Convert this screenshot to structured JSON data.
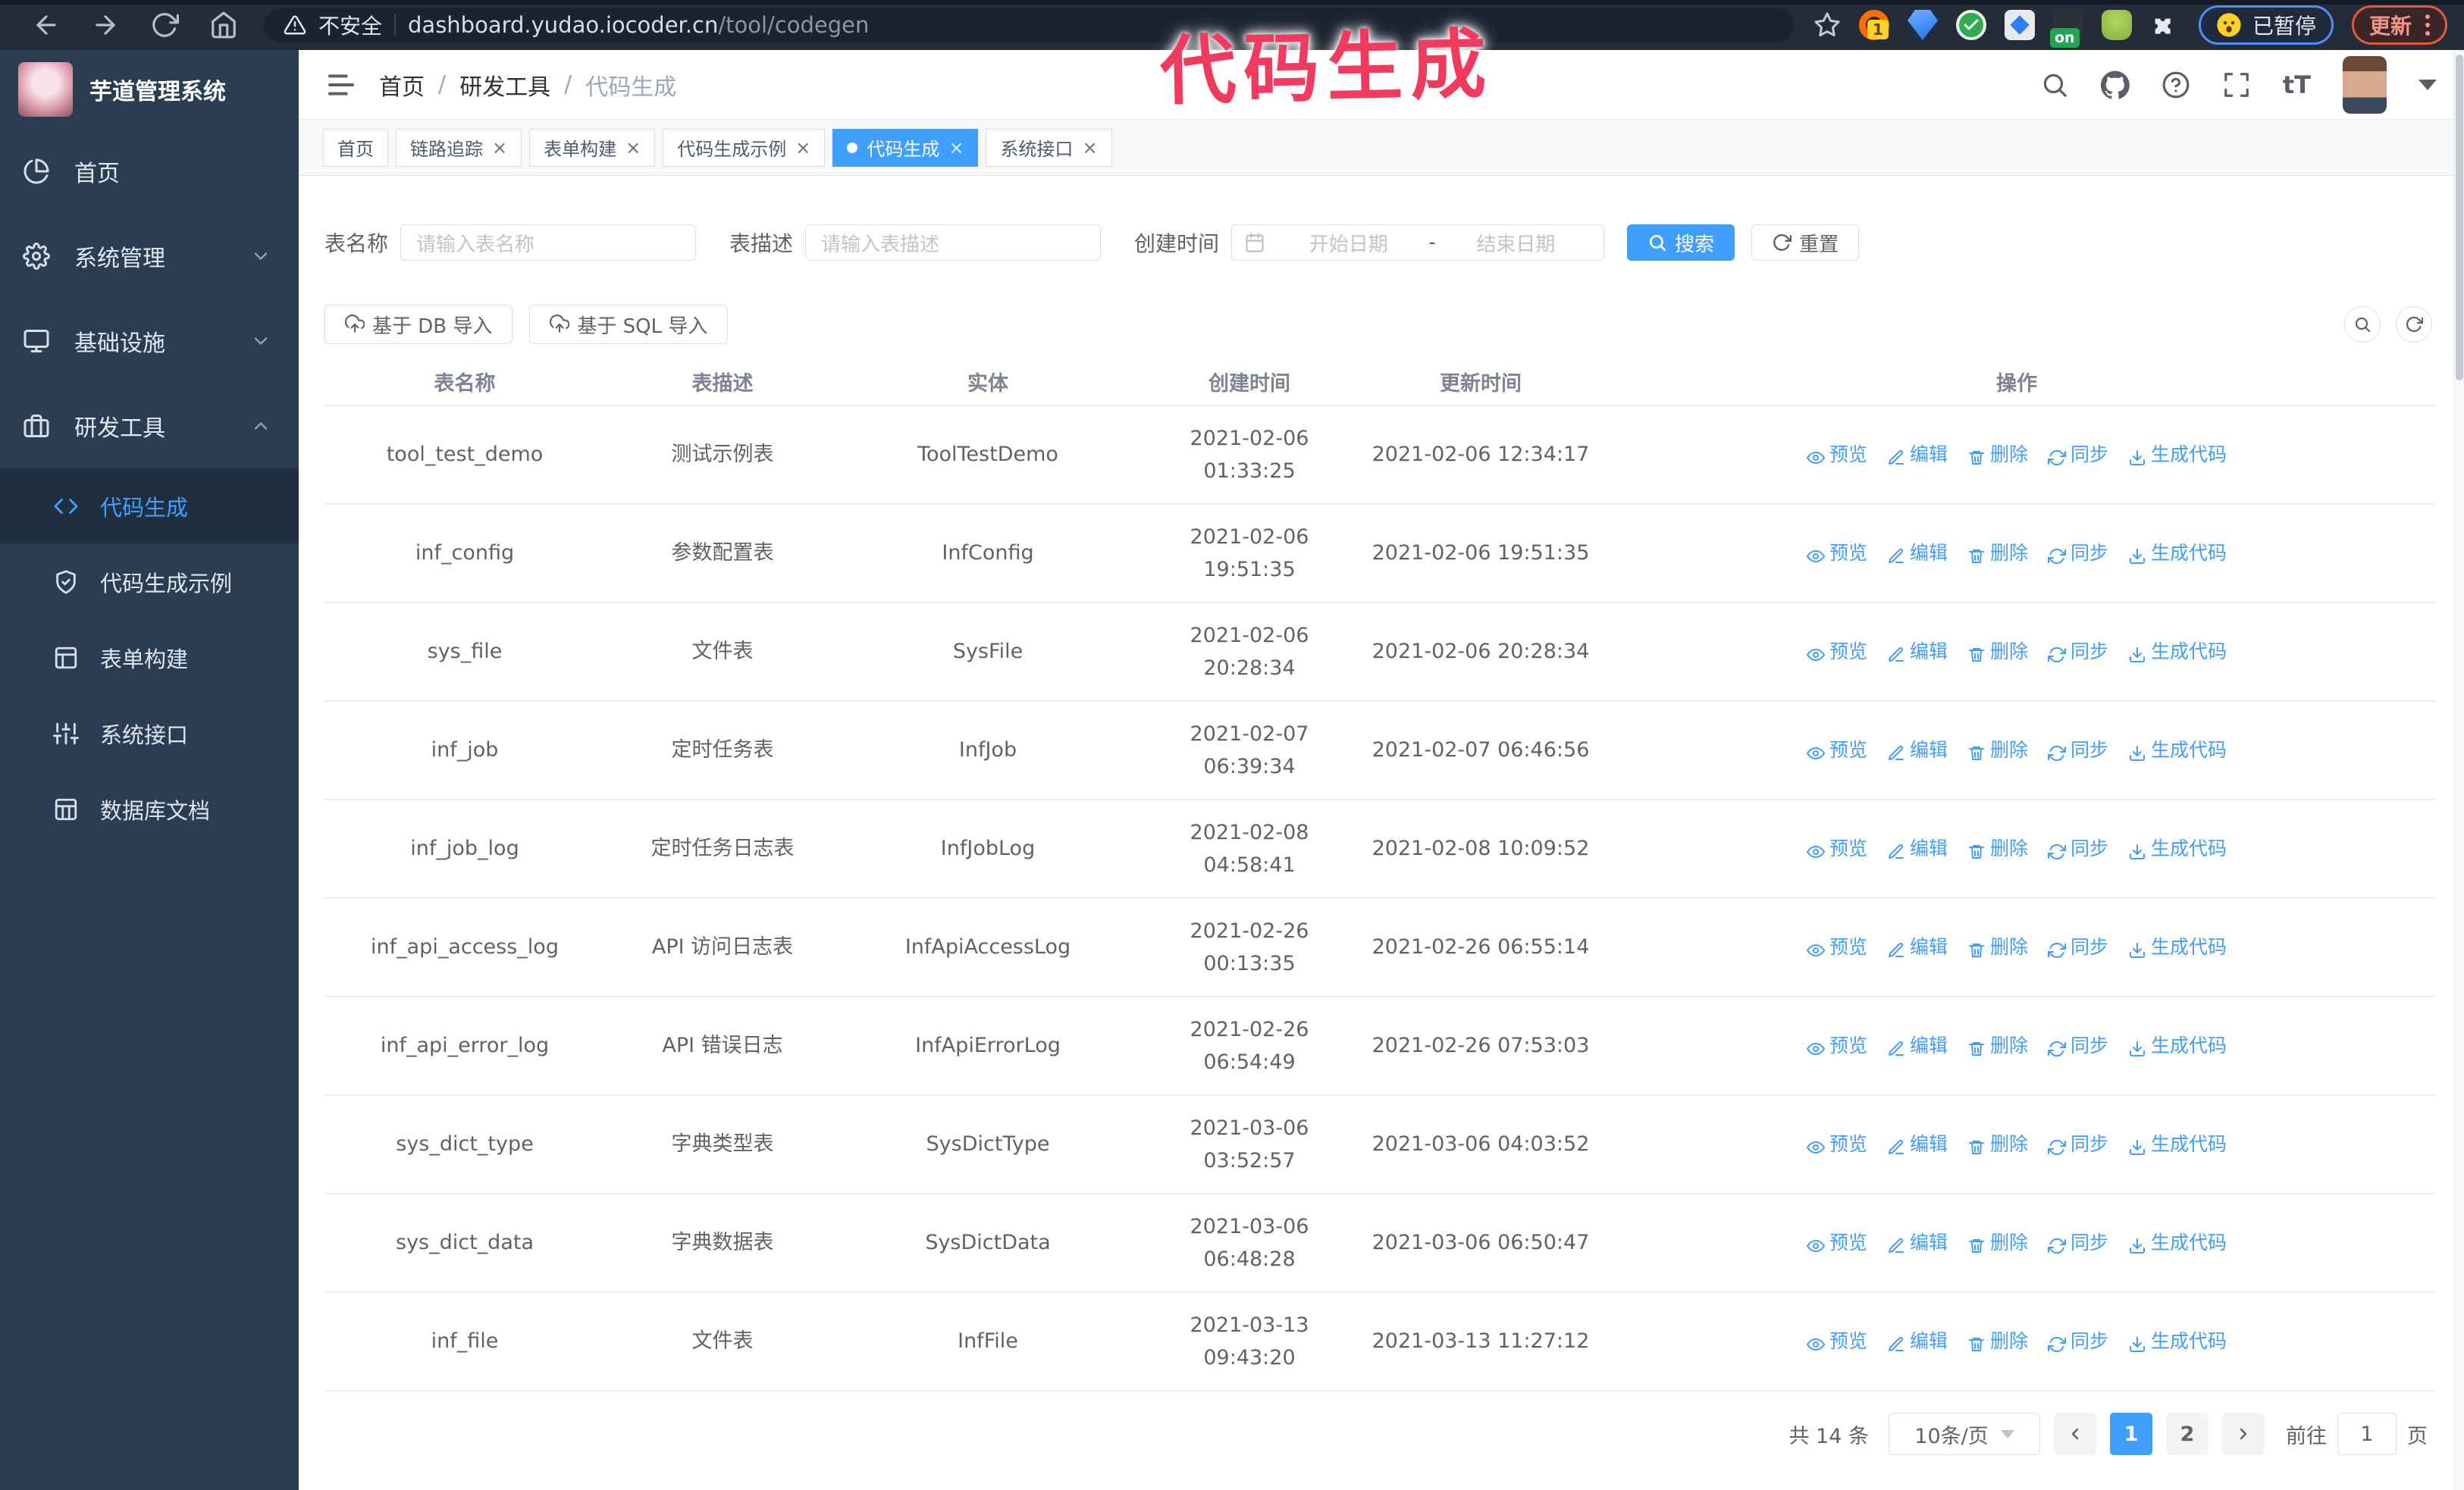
{
  "browser": {
    "security_label": "不安全",
    "url_host": "dashboard.yudao.iocoder.cn",
    "url_path": "/tool/codegen",
    "extension_badge": "1",
    "extension_on_badge": "on",
    "paused_badge": "已暂停",
    "update_button": "更新"
  },
  "annotation": {
    "text": "代码生成",
    "color": "#f23a5f"
  },
  "sidebar": {
    "title": "芋道管理系统",
    "items": [
      {
        "id": "home",
        "label": "首页",
        "icon": "pie-chart-icon",
        "chevron": null
      },
      {
        "id": "system",
        "label": "系统管理",
        "icon": "gear-icon",
        "chevron": "down"
      },
      {
        "id": "infra",
        "label": "基础设施",
        "icon": "monitor-icon",
        "chevron": "down"
      },
      {
        "id": "devtool",
        "label": "研发工具",
        "icon": "toolbox-icon",
        "chevron": "up"
      }
    ],
    "subitems": [
      {
        "id": "codegen",
        "label": "代码生成",
        "icon": "code-icon",
        "active": true
      },
      {
        "id": "codegen-demo",
        "label": "代码生成示例",
        "icon": "shield-icon",
        "active": false
      },
      {
        "id": "form-builder",
        "label": "表单构建",
        "icon": "form-icon",
        "active": false
      },
      {
        "id": "system-api",
        "label": "系统接口",
        "icon": "sliders-icon",
        "active": false
      },
      {
        "id": "db-doc",
        "label": "数据库文档",
        "icon": "columns-icon",
        "active": false
      }
    ]
  },
  "header": {
    "breadcrumb": [
      "首页",
      "研发工具",
      "代码生成"
    ]
  },
  "tabs": [
    {
      "label": "首页",
      "closable": false,
      "active": false
    },
    {
      "label": "链路追踪",
      "closable": true,
      "active": false
    },
    {
      "label": "表单构建",
      "closable": true,
      "active": false
    },
    {
      "label": "代码生成示例",
      "closable": true,
      "active": false
    },
    {
      "label": "代码生成",
      "closable": true,
      "active": true
    },
    {
      "label": "系统接口",
      "closable": true,
      "active": false
    }
  ],
  "filters": {
    "name_label": "表名称",
    "name_placeholder": "请输入表名称",
    "desc_label": "表描述",
    "desc_placeholder": "请输入表描述",
    "time_label": "创建时间",
    "start_placeholder": "开始日期",
    "range_separator": "-",
    "end_placeholder": "结束日期",
    "search_button": "搜索",
    "reset_button": "重置"
  },
  "toolbar": {
    "import_db_button": "基于 DB 导入",
    "import_sql_button": "基于 SQL 导入"
  },
  "table": {
    "columns": [
      "表名称",
      "表描述",
      "实体",
      "创建时间",
      "更新时间",
      "操作"
    ],
    "actions": [
      {
        "id": "preview",
        "label": "预览",
        "icon": "eye-icon"
      },
      {
        "id": "edit",
        "label": "编辑",
        "icon": "edit-icon"
      },
      {
        "id": "delete",
        "label": "删除",
        "icon": "trash-icon"
      },
      {
        "id": "sync",
        "label": "同步",
        "icon": "sync-icon"
      },
      {
        "id": "generate-code",
        "label": "生成代码",
        "icon": "download-icon"
      }
    ],
    "rows": [
      {
        "name": "tool_test_demo",
        "desc": "测试示例表",
        "entity": "ToolTestDemo",
        "created": "2021-02-06 01:33:25",
        "updated": "2021-02-06 12:34:17"
      },
      {
        "name": "inf_config",
        "desc": "参数配置表",
        "entity": "InfConfig",
        "created": "2021-02-06 19:51:35",
        "updated": "2021-02-06 19:51:35"
      },
      {
        "name": "sys_file",
        "desc": "文件表",
        "entity": "SysFile",
        "created": "2021-02-06 20:28:34",
        "updated": "2021-02-06 20:28:34"
      },
      {
        "name": "inf_job",
        "desc": "定时任务表",
        "entity": "InfJob",
        "created": "2021-02-07 06:39:34",
        "updated": "2021-02-07 06:46:56"
      },
      {
        "name": "inf_job_log",
        "desc": "定时任务日志表",
        "entity": "InfJobLog",
        "created": "2021-02-08 04:58:41",
        "updated": "2021-02-08 10:09:52"
      },
      {
        "name": "inf_api_access_log",
        "desc": "API 访问日志表",
        "entity": "InfApiAccessLog",
        "created": "2021-02-26 00:13:35",
        "updated": "2021-02-26 06:55:14"
      },
      {
        "name": "inf_api_error_log",
        "desc": "API 错误日志",
        "entity": "InfApiErrorLog",
        "created": "2021-02-26 06:54:49",
        "updated": "2021-02-26 07:53:03"
      },
      {
        "name": "sys_dict_type",
        "desc": "字典类型表",
        "entity": "SysDictType",
        "created": "2021-03-06 03:52:57",
        "updated": "2021-03-06 04:03:52"
      },
      {
        "name": "sys_dict_data",
        "desc": "字典数据表",
        "entity": "SysDictData",
        "created": "2021-03-06 06:48:28",
        "updated": "2021-03-06 06:50:47"
      },
      {
        "name": "inf_file",
        "desc": "文件表",
        "entity": "InfFile",
        "created": "2021-03-13 09:43:20",
        "updated": "2021-03-13 11:27:12"
      }
    ]
  },
  "pagination": {
    "total": "共 14 条",
    "page_size": "10条/页",
    "pages": [
      "1",
      "2"
    ],
    "active_page": "1",
    "goto_label": "前往",
    "goto_value": "1",
    "page_suffix": "页"
  },
  "colors": {
    "accent": "#409eff",
    "annotation": "#f23a5f",
    "sidebar_bg": "#2a3d53",
    "browser_bar_bg": "#232d3a",
    "paused_border": "#4f8df7",
    "update_border": "#e4593b"
  }
}
